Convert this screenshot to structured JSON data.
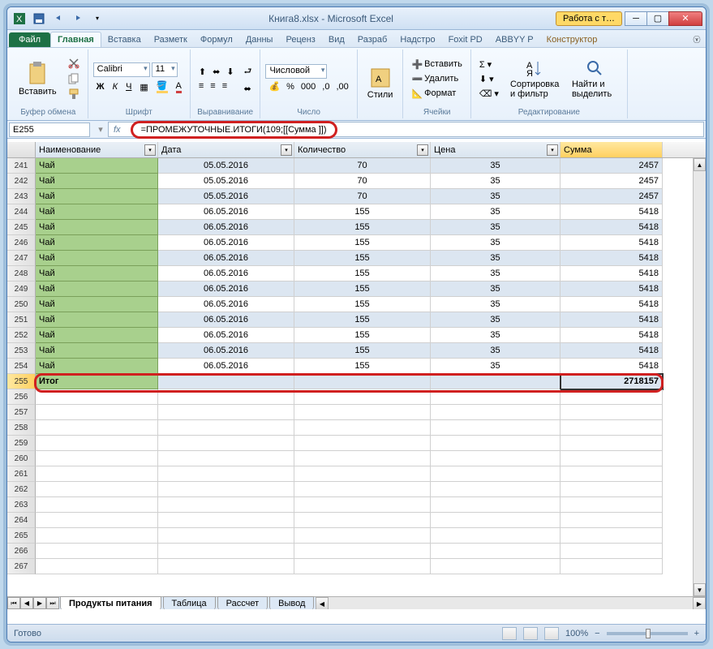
{
  "title": "Книга8.xlsx - Microsoft Excel",
  "tools_tab": "Работа с т…",
  "tabs": {
    "file": "Файл",
    "home": "Главная",
    "insert": "Вставка",
    "layout": "Разметк",
    "formulas": "Формул",
    "data": "Данны",
    "review": "Реценз",
    "view": "Вид",
    "dev": "Разраб",
    "addins": "Надстро",
    "foxit": "Foxit PD",
    "abbyy": "ABBYY P",
    "designer": "Конструктор"
  },
  "ribbon": {
    "clipboard": {
      "paste": "Вставить",
      "label": "Буфер обмена"
    },
    "font": {
      "name": "Calibri",
      "size": "11",
      "label": "Шрифт"
    },
    "align": {
      "label": "Выравнивание"
    },
    "number": {
      "format": "Числовой",
      "label": "Число"
    },
    "styles": {
      "btn": "Стили"
    },
    "cells": {
      "insert": "Вставить",
      "delete": "Удалить",
      "format": "Формат",
      "label": "Ячейки"
    },
    "editing": {
      "sort": "Сортировка и фильтр",
      "find": "Найти и выделить",
      "label": "Редактирование"
    }
  },
  "namebox": "E255",
  "formula": "=ПРОМЕЖУТОЧНЫЕ.ИТОГИ(109;[[Сумма ]])",
  "columns": {
    "name": "Наименование",
    "date": "Дата",
    "qty": "Количество",
    "price": "Цена",
    "sum": "Сумма"
  },
  "rows": [
    {
      "n": 241,
      "name": "Чай",
      "date": "05.05.2016",
      "qty": "70",
      "price": "35",
      "sum": "2457",
      "band": 1
    },
    {
      "n": 242,
      "name": "Чай",
      "date": "05.05.2016",
      "qty": "70",
      "price": "35",
      "sum": "2457",
      "band": 0
    },
    {
      "n": 243,
      "name": "Чай",
      "date": "05.05.2016",
      "qty": "70",
      "price": "35",
      "sum": "2457",
      "band": 1
    },
    {
      "n": 244,
      "name": "Чай",
      "date": "06.05.2016",
      "qty": "155",
      "price": "35",
      "sum": "5418",
      "band": 0
    },
    {
      "n": 245,
      "name": "Чай",
      "date": "06.05.2016",
      "qty": "155",
      "price": "35",
      "sum": "5418",
      "band": 1
    },
    {
      "n": 246,
      "name": "Чай",
      "date": "06.05.2016",
      "qty": "155",
      "price": "35",
      "sum": "5418",
      "band": 0
    },
    {
      "n": 247,
      "name": "Чай",
      "date": "06.05.2016",
      "qty": "155",
      "price": "35",
      "sum": "5418",
      "band": 1
    },
    {
      "n": 248,
      "name": "Чай",
      "date": "06.05.2016",
      "qty": "155",
      "price": "35",
      "sum": "5418",
      "band": 0
    },
    {
      "n": 249,
      "name": "Чай",
      "date": "06.05.2016",
      "qty": "155",
      "price": "35",
      "sum": "5418",
      "band": 1
    },
    {
      "n": 250,
      "name": "Чай",
      "date": "06.05.2016",
      "qty": "155",
      "price": "35",
      "sum": "5418",
      "band": 0
    },
    {
      "n": 251,
      "name": "Чай",
      "date": "06.05.2016",
      "qty": "155",
      "price": "35",
      "sum": "5418",
      "band": 1
    },
    {
      "n": 252,
      "name": "Чай",
      "date": "06.05.2016",
      "qty": "155",
      "price": "35",
      "sum": "5418",
      "band": 0
    },
    {
      "n": 253,
      "name": "Чай",
      "date": "06.05.2016",
      "qty": "155",
      "price": "35",
      "sum": "5418",
      "band": 1
    },
    {
      "n": 254,
      "name": "Чай",
      "date": "06.05.2016",
      "qty": "155",
      "price": "35",
      "sum": "5418",
      "band": 0
    }
  ],
  "total": {
    "n": 255,
    "name": "Итог",
    "sum": "2718157"
  },
  "empty_rows": [
    256,
    257,
    258,
    259,
    260,
    261,
    262,
    263,
    264,
    265,
    266,
    267
  ],
  "sheets": [
    "Продукты питания",
    "Таблица",
    "Рассчет",
    "Вывод"
  ],
  "status": "Готово",
  "zoom": "100%"
}
